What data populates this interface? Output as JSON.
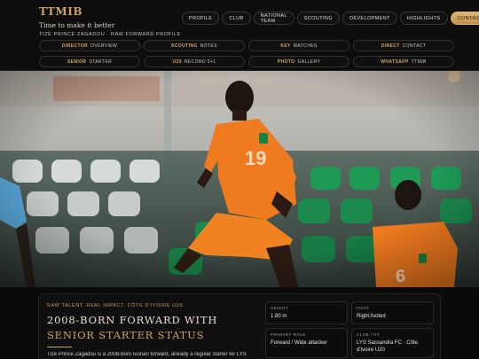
{
  "brand": {
    "title": "TTMIB",
    "tagline": "Time to make it better",
    "subtitle": "Tizé Prince Zagadou · Raw forward profile"
  },
  "nav": [
    {
      "label": "Profile",
      "active": false
    },
    {
      "label": "Club",
      "active": false
    },
    {
      "label": "National Team",
      "active": false
    },
    {
      "label": "Scouting",
      "active": false
    },
    {
      "label": "Development",
      "active": false
    },
    {
      "label": "Highlights",
      "active": false
    },
    {
      "label": "Contact",
      "active": true
    }
  ],
  "quick_links": [
    {
      "key": "Director",
      "rest": "Overview"
    },
    {
      "key": "Scouting",
      "rest": "Notes"
    },
    {
      "key": "Key",
      "rest": "Matches"
    },
    {
      "key": "Direct",
      "rest": "Contact"
    },
    {
      "key": "Senior",
      "rest": "Starter"
    },
    {
      "key": "U20",
      "rest": "Record 5+1"
    },
    {
      "key": "Photo",
      "rest": "Gallery"
    },
    {
      "key": "WhatsApp",
      "rest": "TTMIB"
    }
  ],
  "hero": {
    "main_player_number": "19",
    "second_player_number": "6"
  },
  "intro": {
    "kicker": "Raw talent. Real impact. Côte d'Ivoire U20.",
    "headline_line1": "2008-born forward with",
    "headline_line2": "senior starter status",
    "text": "Tizé Prince Zagadou is a 2008-born Ivorian forward, already a regular starter for LYS"
  },
  "facts": [
    {
      "label": "Height",
      "value": "1.80 m"
    },
    {
      "label": "Foot",
      "value": "Right-footed"
    },
    {
      "label": "Primary role",
      "value": "Forward / Wide attacker"
    },
    {
      "label": "Club / NT",
      "value": "LYS Sassandra FC · Côte d'Ivoire U20"
    }
  ],
  "colors": {
    "gold": "#c9a464",
    "jersey_orange": "#ef7a1f",
    "background": "#0b0b0c"
  }
}
